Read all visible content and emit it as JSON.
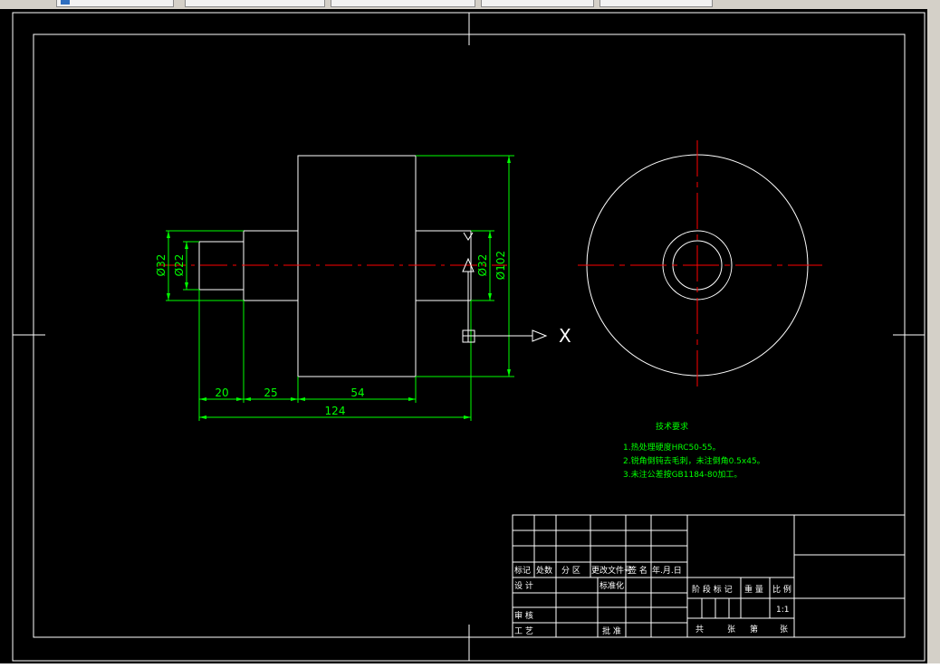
{
  "app": {
    "tabs": [
      {
        "label": ""
      },
      {
        "label": ""
      },
      {
        "label": ""
      },
      {
        "label": ""
      },
      {
        "label": ""
      }
    ],
    "command_line": ""
  },
  "drawing": {
    "dims": {
      "d32_left": "Ø32",
      "d22": "Ø22",
      "d32_right": "Ø32",
      "d102": "Ø102",
      "len20": "20",
      "len25": "25",
      "len54": "54",
      "len124": "124"
    },
    "ucs_x_label": "X",
    "notes": {
      "title": "技术要求",
      "lines": [
        "1.热处理硬度HRC50-55。",
        "2.锐角倒钝去毛刺，未注倒角0.5x45。",
        "3.未注公差按GB1184-80加工。"
      ]
    },
    "title_block": {
      "row_labels": [
        "标记",
        "处数",
        "分 区",
        "更改文件号",
        "签 名",
        "年.月.日"
      ],
      "design": "设 计",
      "standardize": "标准化",
      "review": "审 核",
      "process": "工 艺",
      "approve": "批 准",
      "stage_mark": "阶 段 标 记",
      "weight": "重 量",
      "scale": "比 例",
      "scale_value": "1:1",
      "sheets_total": "共",
      "sheets_label": "张",
      "sheet_no": "第",
      "sheet_label": "张"
    }
  },
  "colors": {
    "background": "#000000",
    "geometry": "#ffffff",
    "dimension": "#00ff00",
    "centerline": "#ff0000"
  }
}
